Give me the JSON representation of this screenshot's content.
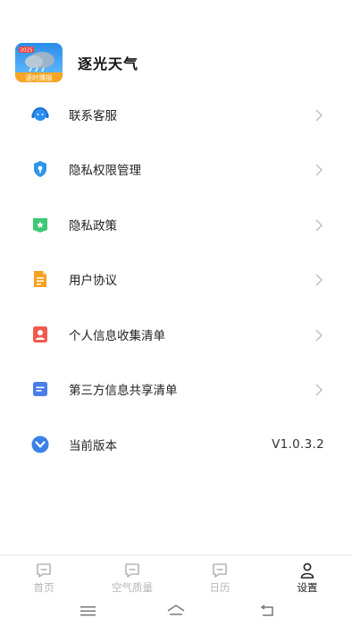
{
  "app": {
    "name": "逐光天气",
    "logo_badge": "2025",
    "logo_text": "逐时播报"
  },
  "menu": [
    {
      "label": "联系客服",
      "icon": "customer-service-icon",
      "color": "#2b8ff5"
    },
    {
      "label": "隐私权限管理",
      "icon": "privacy-shield-icon",
      "color": "#2f95e8"
    },
    {
      "label": "隐私政策",
      "icon": "policy-star-icon",
      "color": "#3ec873"
    },
    {
      "label": "用户协议",
      "icon": "document-icon",
      "color": "#f7a01e"
    },
    {
      "label": "个人信息收集清单",
      "icon": "person-card-icon",
      "color": "#f05a4f"
    },
    {
      "label": "第三方信息共享清单",
      "icon": "list-doc-icon",
      "color": "#4a7de8"
    }
  ],
  "version": {
    "label": "当前版本",
    "value": "V1.0.3.2",
    "icon": "version-chevron-icon",
    "color": "#3a82e8"
  },
  "tabs": [
    {
      "label": "首页",
      "active": false
    },
    {
      "label": "空气质量",
      "active": false
    },
    {
      "label": "日历",
      "active": false
    },
    {
      "label": "设置",
      "active": true
    }
  ]
}
